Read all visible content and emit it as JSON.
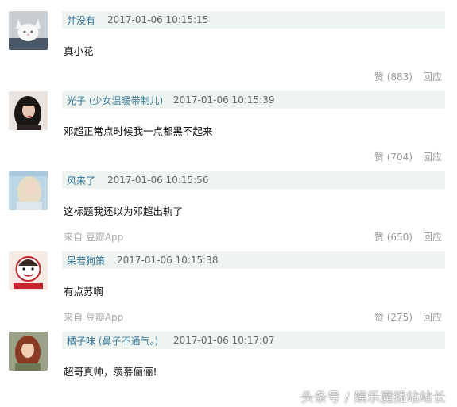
{
  "comments": [
    {
      "author": "并没有",
      "author_note": "",
      "time": "2017-01-06 10:15:15",
      "content": "真小花",
      "source": "",
      "like_label": "赞 (883)",
      "reply_label": "回应",
      "avatar_icon": "cat-avatar-icon"
    },
    {
      "author": "光子",
      "author_note": "(少女温暖带制儿)",
      "time": "2017-01-06 10:15:39",
      "content": "邓超正常点时候我一点都黑不起来",
      "source": "",
      "like_label": "赞 (704)",
      "reply_label": "回应",
      "avatar_icon": "dark-hair-girl-avatar-icon"
    },
    {
      "author": "风来了",
      "author_note": "",
      "time": "2017-01-06 10:15:56",
      "content": "这标题我还以为邓超出轨了",
      "source": "来自 豆瓣App",
      "like_label": "赞 (650)",
      "reply_label": "回应",
      "avatar_icon": "blonde-girl-avatar-icon"
    },
    {
      "author": "呆若狗策",
      "author_note": "",
      "time": "2017-01-06 10:15:38",
      "content": "有点苏啊",
      "source": "来自 豆瓣App",
      "like_label": "赞 (275)",
      "reply_label": "回应",
      "avatar_icon": "cartoon-face-avatar-icon"
    },
    {
      "author": "橘子味",
      "author_note": "(鼻子不通气。)",
      "time": "2017-01-06 10:17:07",
      "content": "超哥真帅，羡慕俪俪!",
      "source": "",
      "like_label": "",
      "reply_label": "",
      "avatar_icon": "red-hair-girl-avatar-icon"
    }
  ],
  "watermark": "头条号 / 娱乐魔播站站长"
}
